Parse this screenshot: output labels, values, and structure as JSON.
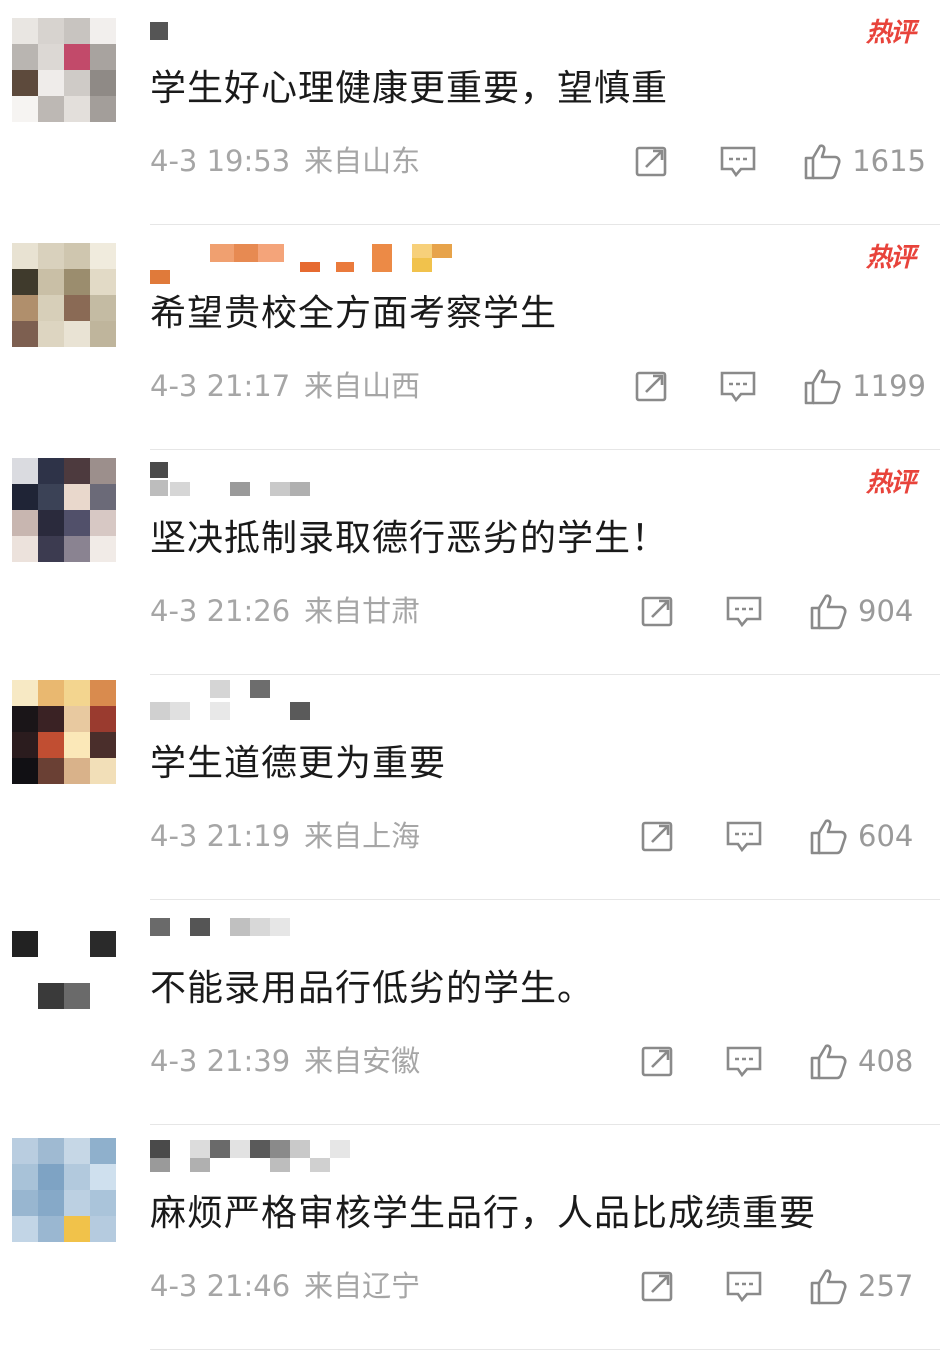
{
  "hot_label": "热评",
  "icons": {
    "share": "share-icon",
    "reply": "reply-icon",
    "like": "thumbs-up-icon"
  },
  "comments": [
    {
      "text": "学生好心理健康更重要，望慎重",
      "date": "4-3 19:53",
      "location": "来自山东",
      "likes": "1615",
      "hot": true
    },
    {
      "text": "希望贵校全方面考察学生",
      "date": "4-3 21:17",
      "location": "来自山西",
      "likes": "1199",
      "hot": true
    },
    {
      "text": "坚决抵制录取德行恶劣的学生！",
      "date": "4-3 21:26",
      "location": "来自甘肃",
      "likes": "904",
      "hot": true
    },
    {
      "text": "学生道德更为重要",
      "date": "4-3 21:19",
      "location": "来自上海",
      "likes": "604",
      "hot": false
    },
    {
      "text": "不能录用品行低劣的学生。",
      "date": "4-3 21:39",
      "location": "来自安徽",
      "likes": "408",
      "hot": false
    },
    {
      "text": "麻烦严格审核学生品行，人品比成绩重要",
      "date": "4-3 21:46",
      "location": "来自辽宁",
      "likes": "257",
      "hot": false
    }
  ]
}
